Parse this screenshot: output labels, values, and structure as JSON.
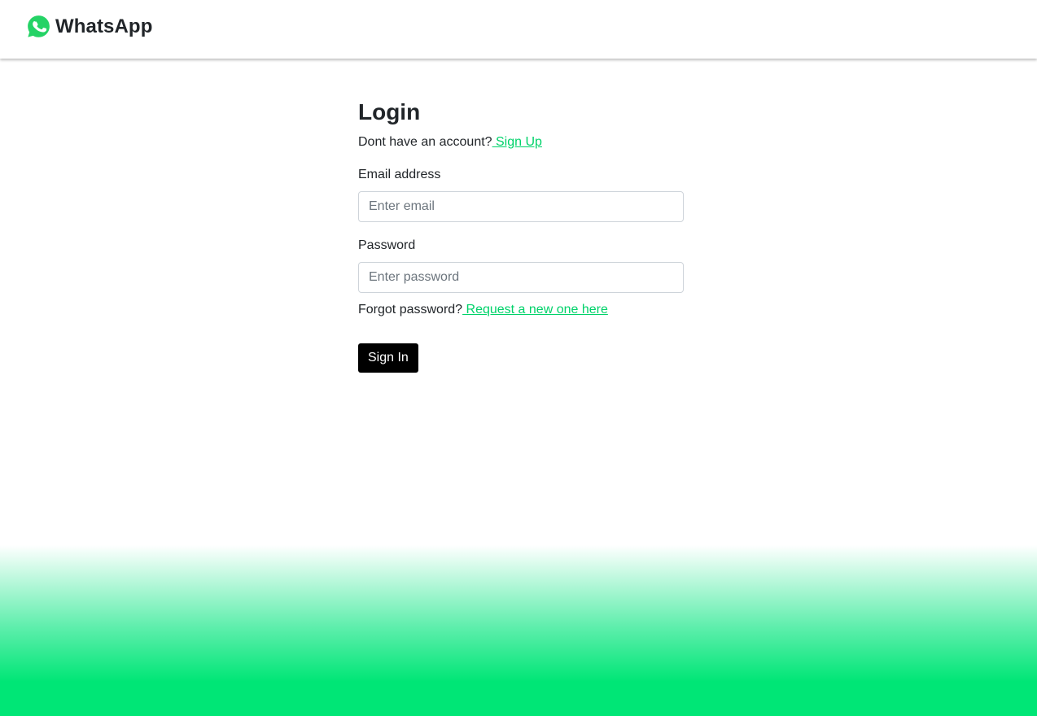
{
  "brand": {
    "name": "WhatsApp",
    "logo_icon": "whatsapp-logo-icon",
    "logo_color": "#25D366"
  },
  "login": {
    "title": "Login",
    "signup_prompt": "Dont have an account?",
    "signup_link": " Sign Up",
    "email": {
      "label": "Email address",
      "placeholder": "Enter email",
      "value": ""
    },
    "password": {
      "label": "Password",
      "placeholder": "Enter password",
      "value": ""
    },
    "forgot_prompt": "Forgot password?",
    "forgot_link": " Request a new one here",
    "submit_label": "Sign In"
  },
  "colors": {
    "link": "#00D26A",
    "button_bg": "#000000",
    "gradient_bottom": "#00E676"
  }
}
